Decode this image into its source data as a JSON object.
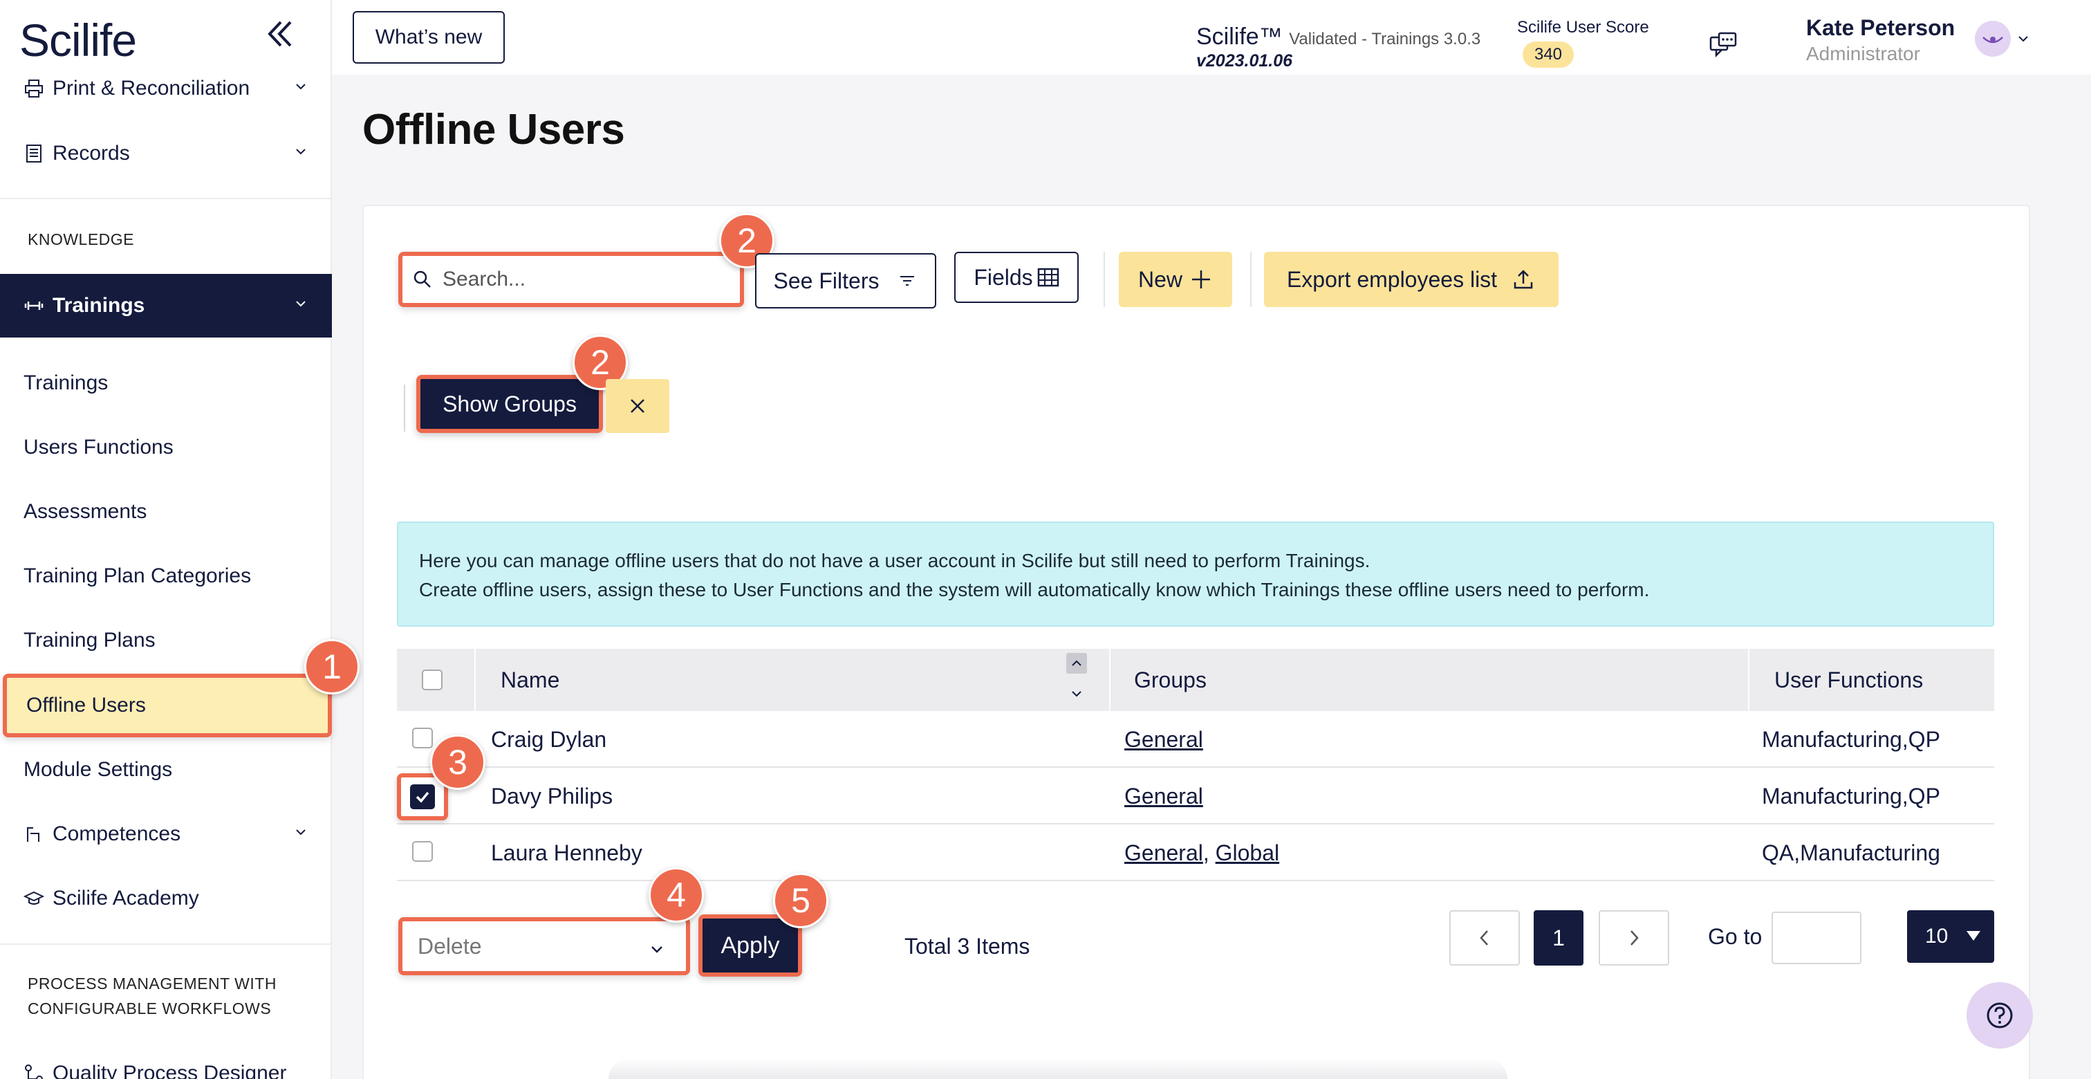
{
  "app": {
    "logo": "Scilife"
  },
  "topbar": {
    "whats_new": "What’s new",
    "brand": "Scilife™",
    "brand_sub": "Validated - Trainings 3.0.3",
    "version": "v2023.01.06",
    "score_label": "Scilife User Score",
    "score_value": "340",
    "user_name": "Kate Peterson",
    "user_role": "Administrator"
  },
  "sidebar": {
    "items": [
      {
        "label": "Print & Reconciliation",
        "icon": "printer-icon"
      },
      {
        "label": "Records",
        "icon": "records-icon"
      }
    ],
    "section_knowledge": "KNOWLEDGE",
    "trainings_group": {
      "label": "Trainings",
      "icon": "dumbbell-icon"
    },
    "sub_items": [
      "Trainings",
      "Users Functions",
      "Assessments",
      "Training Plan Categories",
      "Training Plans",
      "Offline Users",
      "Module Settings"
    ],
    "more_items": [
      {
        "label": "Competences",
        "icon": "competences-icon"
      },
      {
        "label": "Scilife Academy",
        "icon": "graduation-cap-icon"
      }
    ],
    "section_process": "PROCESS MANAGEMENT WITH CONFIGURABLE WORKFLOWS",
    "process_item": {
      "label": "Quality Process Designer",
      "icon": "workflow-icon"
    }
  },
  "main": {
    "title": "Offline Users",
    "search_placeholder": "Search...",
    "see_filters": "See Filters",
    "fields": "Fields",
    "new": "New",
    "export": "Export employees list",
    "show_groups": "Show Groups",
    "info_line1": "Here you can manage offline users that do not have a user account in Scilife but still need to perform Trainings.",
    "info_line2": "Create offline users, assign these to User Functions and the system will automatically know which Trainings these offline users need to perform.",
    "columns": {
      "name": "Name",
      "groups": "Groups",
      "user_functions": "User Functions"
    },
    "rows": [
      {
        "name": "Craig Dylan",
        "groups": [
          "General"
        ],
        "functions": "Manufacturing,QP",
        "checked": false
      },
      {
        "name": "Davy Philips",
        "groups": [
          "General"
        ],
        "functions": "Manufacturing,QP",
        "checked": true
      },
      {
        "name": "Laura Henneby",
        "groups": [
          "General",
          "Global"
        ],
        "functions": "QA,Manufacturing",
        "checked": false
      }
    ],
    "group_separator": ", ",
    "bulk_action": "Delete",
    "apply": "Apply",
    "total": "Total 3 Items",
    "current_page": "1",
    "go_to": "Go to",
    "page_size": "10"
  },
  "callouts": [
    "1",
    "2",
    "2",
    "3",
    "4",
    "5"
  ],
  "colors": {
    "navy": "#141b3d",
    "accent_yellow": "#fbe39a",
    "callout_orange": "#ee6a4e",
    "info_bg": "#cdf3f7"
  }
}
